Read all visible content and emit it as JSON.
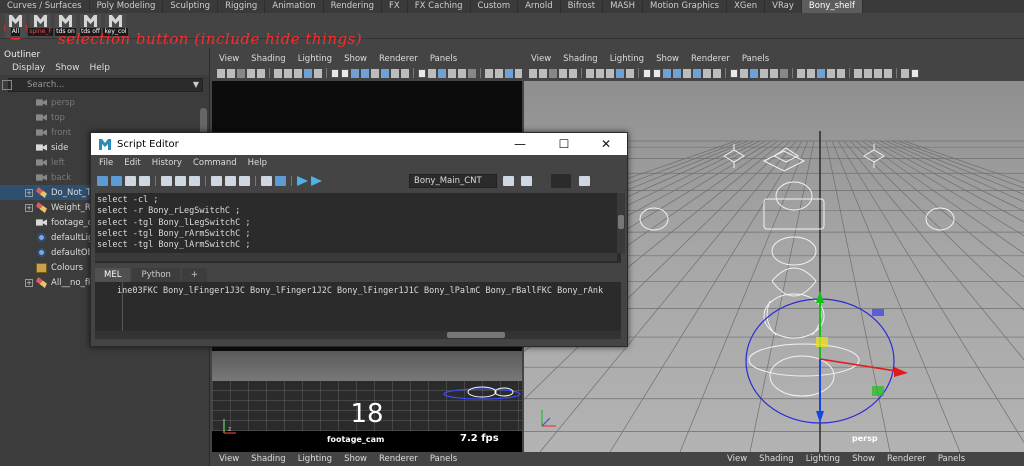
{
  "shelf_tabs": [
    "Curves / Surfaces",
    "Poly Modeling",
    "Sculpting",
    "Rigging",
    "Animation",
    "Rendering",
    "FX",
    "FX Caching",
    "Custom",
    "Arnold",
    "Bifrost",
    "MASH",
    "Motion Graphics",
    "XGen",
    "VRay",
    "Bony_shelf"
  ],
  "shelf_active_tab": "Bony_shelf",
  "shelf_buttons": [
    {
      "label": "All",
      "color": "#ffffff"
    },
    {
      "label": "spine_F",
      "color": "#ff4040"
    },
    {
      "label": "tds on",
      "color": "#ffffff"
    },
    {
      "label": "tds off",
      "color": "#ffffff"
    },
    {
      "label": "key_col",
      "color": "#ffffff"
    }
  ],
  "annotation": {
    "text": "selection button (include hide things)",
    "color": "#ff2a2a"
  },
  "outliner": {
    "title": "Outliner",
    "menu": [
      "Display",
      "Show",
      "Help"
    ],
    "search_placeholder": "Search...",
    "items": [
      {
        "label": "persp",
        "icon": "camera-icon",
        "dim": true
      },
      {
        "label": "top",
        "icon": "camera-icon",
        "dim": true
      },
      {
        "label": "front",
        "icon": "camera-icon",
        "dim": true
      },
      {
        "label": "side",
        "icon": "camera-icon",
        "dim": false
      },
      {
        "label": "left",
        "icon": "camera-icon",
        "dim": true
      },
      {
        "label": "back",
        "icon": "camera-icon",
        "dim": true
      },
      {
        "label": "Do_Not_T",
        "icon": "reference-icon",
        "expand": true,
        "selected": true
      },
      {
        "label": "Weight_R",
        "icon": "reference-icon",
        "expand": true
      },
      {
        "label": "footage_c",
        "icon": "camera-icon"
      },
      {
        "label": "defaultLig",
        "icon": "set-icon"
      },
      {
        "label": "defaultOb",
        "icon": "set-icon"
      },
      {
        "label": "Colours",
        "icon": "group-icon"
      },
      {
        "label": "All__no_fk",
        "icon": "reference-icon",
        "expand": true
      }
    ]
  },
  "viewport_menu": [
    "View",
    "Shading",
    "Lighting",
    "Show",
    "Renderer",
    "Panels"
  ],
  "viewport_left": {
    "frame_number": "18",
    "camera_name": "footage_cam",
    "fps": "7.2 fps"
  },
  "viewport_right": {
    "camera_name": "persp"
  },
  "script_editor": {
    "title": "Script Editor",
    "menu": [
      "File",
      "Edit",
      "History",
      "Command",
      "Help"
    ],
    "search_field": "Bony_Main_CNT",
    "history_lines": [
      "select -cl  ;",
      "select -r Bony_rLegSwitchC ;",
      "select -tgl Bony_lLegSwitchC ;",
      "select -tgl Bony_rArmSwitchC ;",
      "select -tgl Bony_lArmSwitchC ;"
    ],
    "tabs": [
      "MEL",
      "Python",
      "+"
    ],
    "active_tab": "MEL",
    "input_line": "ine03FKC Bony_lFinger1J3C Bony_lFinger1J2C Bony_lFinger1J1C Bony_lPalmC Bony_rBallFKC Bony_rAnk",
    "window_controls": {
      "minimize": "—",
      "maximize": "☐",
      "close": "✕"
    }
  }
}
